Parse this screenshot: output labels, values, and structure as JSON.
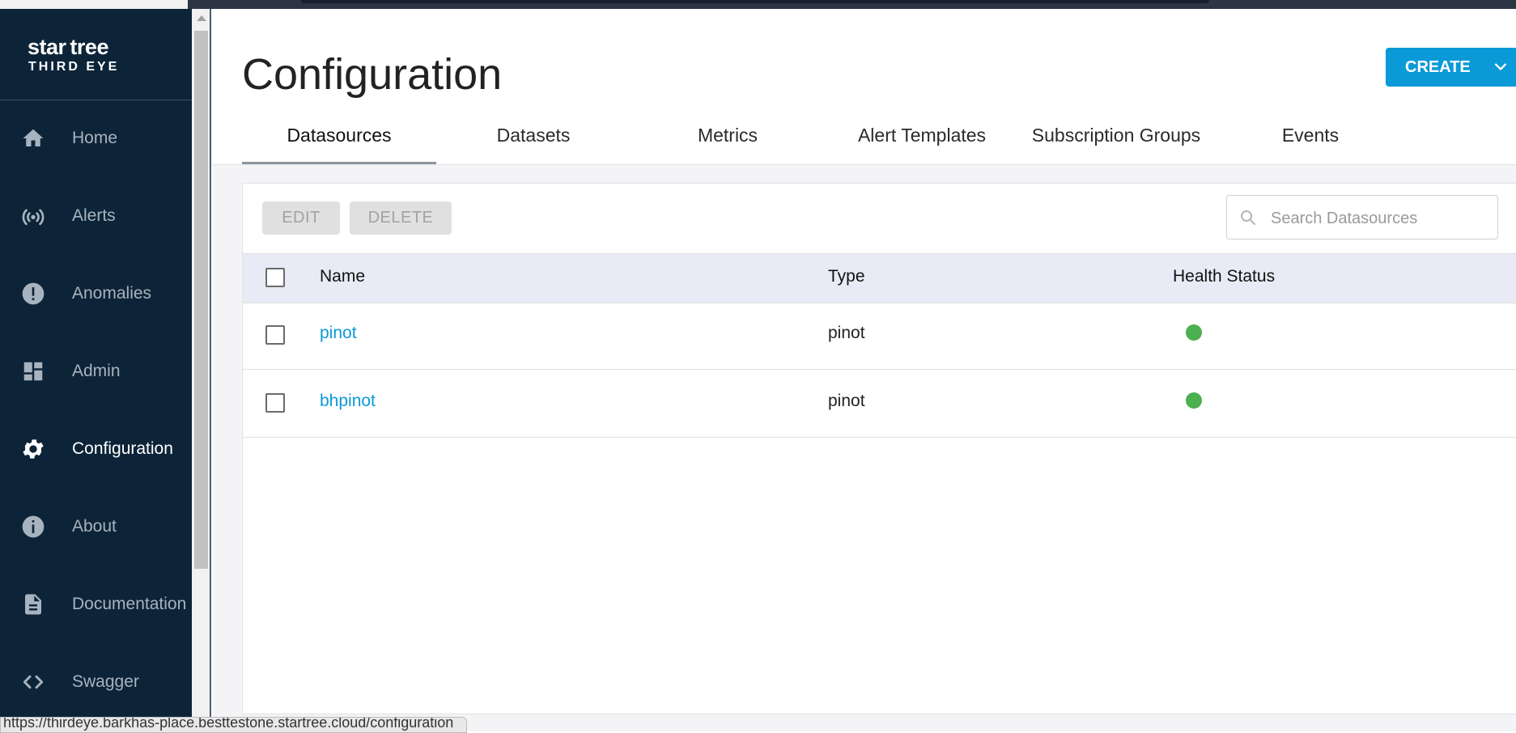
{
  "app": {
    "logo_line1": "star tree",
    "logo_line2": "THIRD EYE"
  },
  "sidebar": {
    "items": [
      {
        "label": "Home",
        "icon": "home-icon"
      },
      {
        "label": "Alerts",
        "icon": "alert-signal-icon"
      },
      {
        "label": "Anomalies",
        "icon": "exclamation-icon"
      },
      {
        "label": "Admin",
        "icon": "dashboard-icon"
      },
      {
        "label": "Configuration",
        "icon": "gear-icon",
        "active": true
      },
      {
        "label": "About",
        "icon": "info-icon"
      },
      {
        "label": "Documentation",
        "icon": "document-icon"
      },
      {
        "label": "Swagger",
        "icon": "code-icon"
      }
    ]
  },
  "header": {
    "title": "Configuration",
    "create_label": "CREATE"
  },
  "tabs": [
    "Datasources",
    "Datasets",
    "Metrics",
    "Alert Templates",
    "Subscription Groups",
    "Events"
  ],
  "toolbar": {
    "edit_label": "EDIT",
    "delete_label": "DELETE",
    "search_placeholder": "Search Datasources"
  },
  "table": {
    "columns": [
      "Name",
      "Type",
      "Health Status"
    ],
    "rows": [
      {
        "name": "pinot",
        "type": "pinot",
        "health": "healthy"
      },
      {
        "name": "bhpinot",
        "type": "pinot",
        "health": "healthy"
      }
    ]
  },
  "status_url": "https://thirdeye.barkhas-place.besttestone.startree.cloud/configuration",
  "colors": {
    "sidebar_bg": "#0d2438",
    "accent": "#0a9ad8",
    "healthy": "#4caf50",
    "table_header_bg": "#e8ebf5"
  }
}
